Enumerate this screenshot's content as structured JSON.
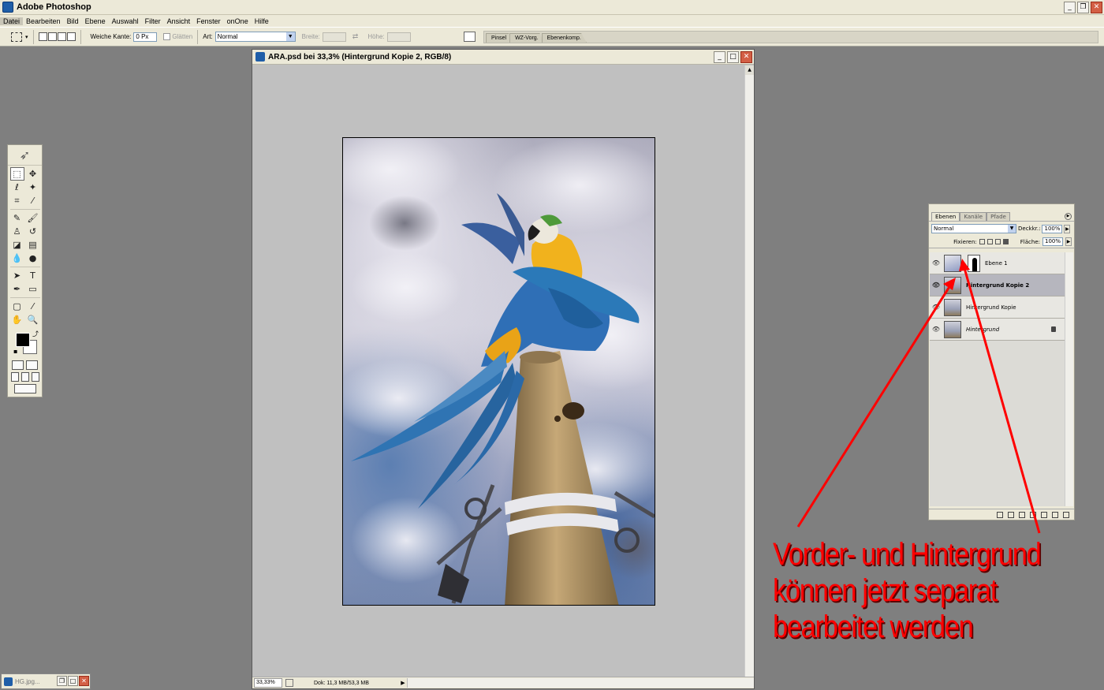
{
  "app": {
    "title": "Adobe Photoshop"
  },
  "menu": [
    "Datei",
    "Bearbeiten",
    "Bild",
    "Ebene",
    "Auswahl",
    "Filter",
    "Ansicht",
    "Fenster",
    "onOne",
    "Hilfe"
  ],
  "options": {
    "feather_label": "Weiche Kante:",
    "feather_value": "0 Px",
    "smooth_label": "Glätten",
    "style_label": "Art:",
    "style_value": "Normal",
    "width_label": "Breite:",
    "height_label": "Höhe:"
  },
  "palette_well": [
    "Pinsel",
    "WZ-Vorg.",
    "Ebenenkomp."
  ],
  "document": {
    "title": "ARA.psd bei 33,3% (Hintergrund Kopie 2, RGB/8)",
    "zoom": "33,33%",
    "doc_info": "Dok: 11,3 MB/53,3 MB"
  },
  "layers_panel": {
    "tabs": [
      "Ebenen",
      "Kanäle",
      "Pfade"
    ],
    "blend_mode": "Normal",
    "opacity_label": "Deckkr.:",
    "opacity_value": "100%",
    "lock_label": "Fixieren:",
    "fill_label": "Fläche:",
    "fill_value": "100%",
    "layers": [
      {
        "name": "Ebene 1"
      },
      {
        "name": "Hintergrund Kopie 2"
      },
      {
        "name": "Hintergrund Kopie"
      },
      {
        "name": "Hintergrund"
      }
    ]
  },
  "minimized": {
    "title": "HG.jpg..."
  },
  "annotation": {
    "line1": "Vorder- und Hintergrund",
    "line2": "können jetzt separat",
    "line3": "bearbeitet werden",
    "color": "#ff0000"
  }
}
